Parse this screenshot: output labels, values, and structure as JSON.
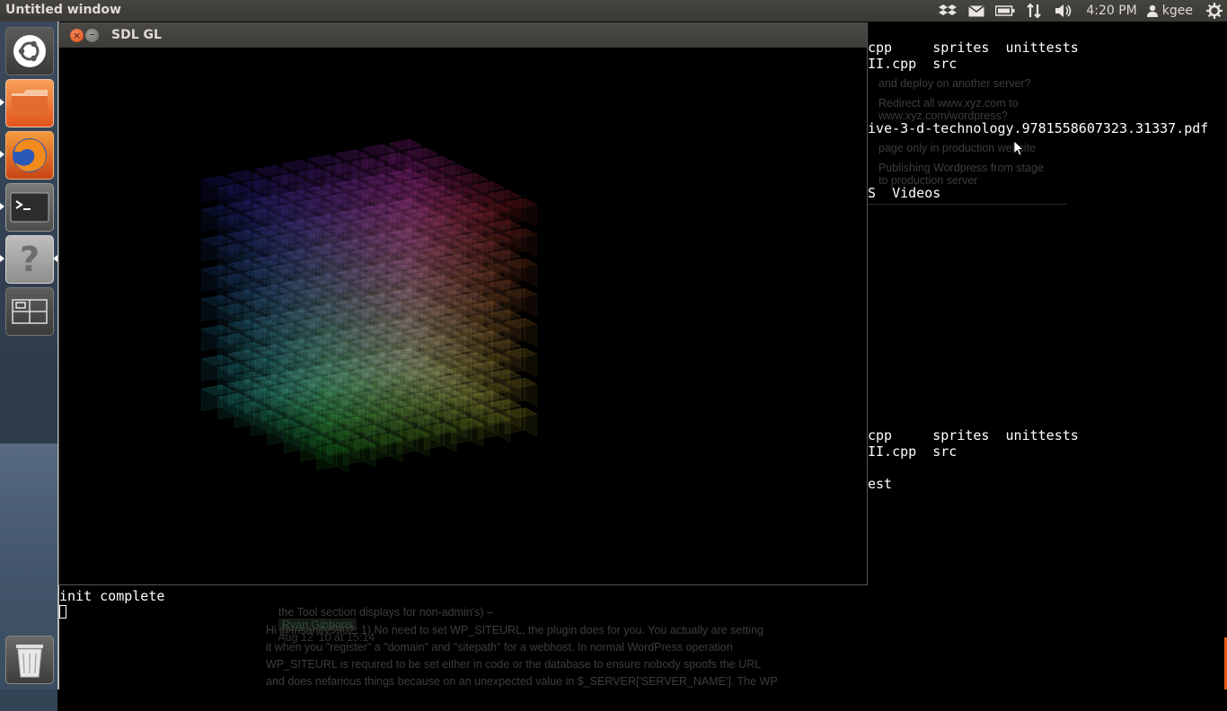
{
  "panel": {
    "title": "Untitled window",
    "clock": "4:20 PM",
    "user": "kgee"
  },
  "sdl_window": {
    "title": "SDL GL"
  },
  "terminal_lines": [
    "cpp     sprites  unittests",
    "II.cpp  src",
    "ive-3-d-technology.9781558607323.31337.pdf",
    "S  Videos",
    "cpp     sprites  unittests",
    "II.cpp  src",
    "est",
    "init complete"
  ],
  "browser_ghost": {
    "links": [
      "and deploy on another server?",
      "Redirect all www.xyz.com to",
      "www.xyz.com/wordpress?",
      "page only in production website",
      "Publishing Wordpress from stage",
      "to production server"
    ],
    "comment_tail": "the Tool section displays for non-admin's) –",
    "comment_user": "Ryan Gibbons",
    "comment_date": "Aug 12 '10 at 15:14",
    "answer_lines": [
      "Hi @Insanity5902: 1) No need to set WP_SITEURL, the plugin does for you. You actually are setting",
      "it when you \"register\" a \"domain\" and \"sitepath\" for a webhost. In normal WordPress operation",
      "WP_SITEURL is required to be set either in code or the database to ensure nobody spoofs the URL",
      "and does nefarious things because on an unexpected value in $_SERVER['SERVER_NAME']. The WP"
    ]
  },
  "launcher_items": [
    "ubuntu-home",
    "files",
    "firefox",
    "terminal",
    "help",
    "workspaces",
    "trash"
  ]
}
